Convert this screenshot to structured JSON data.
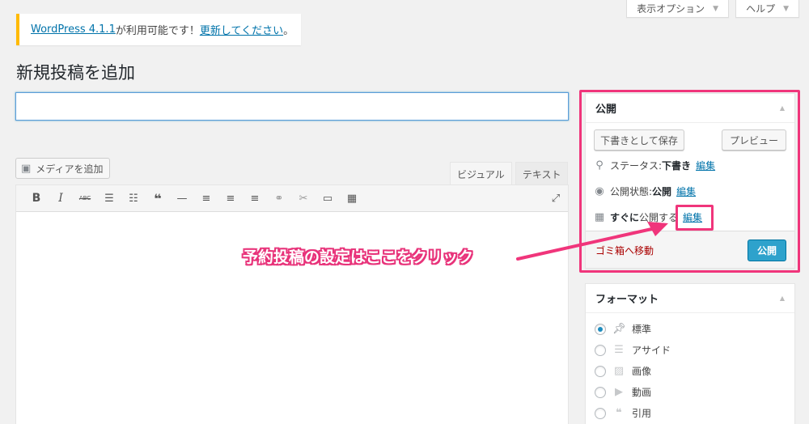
{
  "screen_meta": {
    "display_options": "表示オプション",
    "help": "ヘルプ"
  },
  "notice": {
    "version_link": "WordPress 4.1.1",
    "middle_text": " が利用可能です！",
    "update_link": "更新してください",
    "end": "。"
  },
  "page_title": "新規投稿を追加",
  "title_input": {
    "value": "",
    "placeholder": ""
  },
  "editor": {
    "add_media": "メディアを追加",
    "tabs": [
      {
        "label": "ビジュアル",
        "active": true
      },
      {
        "label": "テキスト",
        "active": false
      }
    ],
    "toolbar_icons": [
      "bold-icon",
      "italic-icon",
      "strikethrough-icon",
      "bulleted-list-icon",
      "numbered-list-icon",
      "blockquote-icon",
      "horizontal-rule-icon",
      "align-left-icon",
      "align-center-icon",
      "align-right-icon",
      "insert-link-icon",
      "unlink-icon",
      "insert-more-icon",
      "toolbar-toggle-icon",
      "fullscreen-icon"
    ]
  },
  "publish_box": {
    "title": "公開",
    "save_draft": "下書きとして保存",
    "preview": "プレビュー",
    "status_label": "ステータス: ",
    "status_value": "下書き",
    "status_edit": "編集",
    "visibility_label": "公開状態: ",
    "visibility_value": "公開",
    "visibility_edit": "編集",
    "schedule_label_bold": "すぐに",
    "schedule_label": "公開する",
    "schedule_edit": "編集",
    "trash": "ゴミ箱へ移動",
    "publish": "公開"
  },
  "format_box": {
    "title": "フォーマット",
    "options": [
      {
        "label": "標準",
        "icon": "pin-icon",
        "checked": true
      },
      {
        "label": "アサイド",
        "icon": "aside-icon",
        "checked": false
      },
      {
        "label": "画像",
        "icon": "image-icon",
        "checked": false
      },
      {
        "label": "動画",
        "icon": "video-icon",
        "checked": false
      },
      {
        "label": "引用",
        "icon": "quote-icon",
        "checked": false
      }
    ]
  },
  "annotation": {
    "callout_text": "予約投稿の設定はここをクリック",
    "color": "#f0357b"
  },
  "colors": {
    "link": "#0073aa",
    "primary_button": "#2ea2cc",
    "notice_border": "#ffba00"
  }
}
